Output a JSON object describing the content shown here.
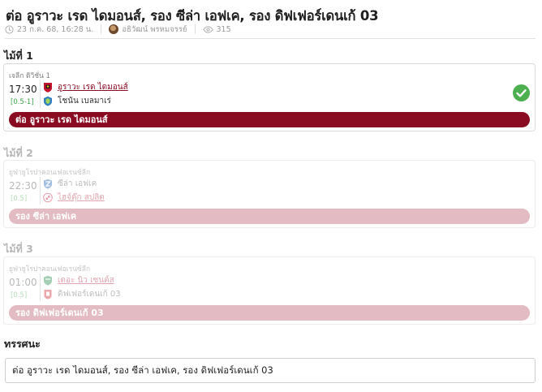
{
  "header": {
    "title": "ต่อ อูราวะ เรด ไดมอนส์, รอง ซีล่า เอฟเค, รอง ดิฟเฟอร์เดนเก้ 03",
    "date": "23 ก.ค. 68, 16:28 น.",
    "author": "อธิวัฒน์ พรหมจรรย์",
    "views": "315",
    "icons": [
      "clock-icon",
      "avatar",
      "eye-icon"
    ]
  },
  "tips": [
    {
      "label": "ไม้ที่ 1",
      "league": "เจลีก ดิวิชั่น 1",
      "time": "17:30",
      "handicap": "[0.5-1]",
      "home": "อูราวะ เรด ไดมอนส์",
      "away": "โชนัน เบลมาเร่",
      "favorite": "home",
      "pick": "ต่อ อูราวะ เรด ไดมอนส์",
      "result": "won",
      "active": true
    },
    {
      "label": "ไม้ที่ 2",
      "league": "ยูฟ่ายูโรปาคอนเฟอเรนซ์ลีก",
      "time": "22:30",
      "handicap": "[0.5]",
      "home": "ซีล่า เอฟเค",
      "away": "ไฮจ์ดุ๊ก สปลิต",
      "favorite": "away",
      "pick": "รอง ซีล่า เอฟเค",
      "result": "",
      "active": false
    },
    {
      "label": "ไม้ที่ 3",
      "league": "ยูฟ่ายูโรปาคอนเฟอเรนซ์ลีก",
      "time": "01:00",
      "handicap": "[0.5]",
      "home": "เดอะ นิว เซนต์ส",
      "away": "ดิฟเฟอร์เดนเก้ 03",
      "favorite": "home",
      "pick": "รอง ดิฟเฟอร์เดนเก้ 03",
      "result": "",
      "active": false
    }
  ],
  "summary": {
    "label": "ทรรศนะ",
    "text": "ต่อ อูราวะ เรด ไดมอนส์, รอง ซีล่า เอฟเค, รอง ดิฟเฟอร์เดนเก้ 03"
  },
  "colors": {
    "accent": "#8a0c22",
    "accent_dim": "#e2bcc2",
    "handicap": "#3fa24a",
    "success": "#4caf50"
  }
}
